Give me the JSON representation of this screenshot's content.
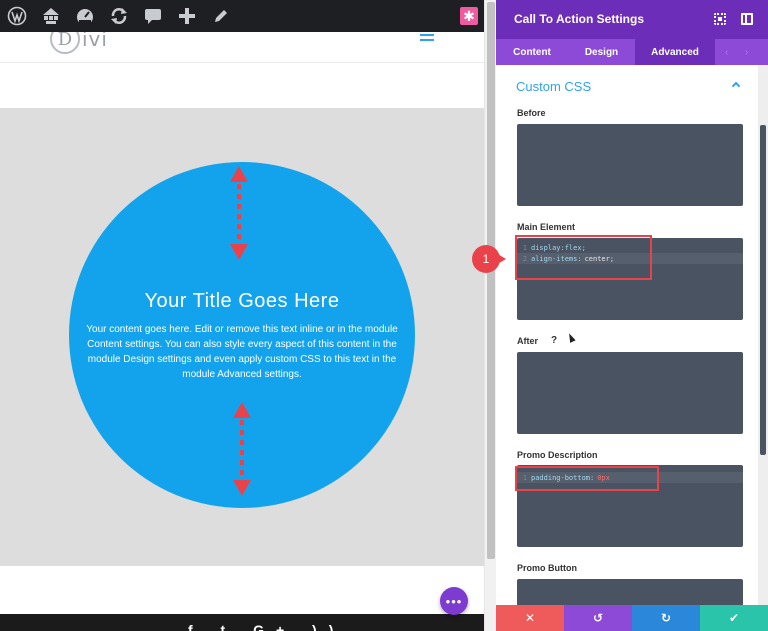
{
  "admin_bar": {
    "icons": [
      "wordpress-icon",
      "sitemap-icon",
      "dashboard-icon",
      "refresh-icon",
      "comment-icon",
      "plus-icon",
      "edit-icon"
    ],
    "star_icon": "star-icon"
  },
  "site": {
    "logo_letter": "D",
    "logo_text": "ivi"
  },
  "cta": {
    "title": "Your Title Goes Here",
    "description": "Your content goes here. Edit or remove this text inline or in the module Content settings. You can also style every aspect of this content in the module Design settings and even apply custom CSS to this text in the module Advanced settings.",
    "background": "#13a3ec"
  },
  "footer": {
    "social": "f  t  G+  ))",
    "menu_button": "•••"
  },
  "panel": {
    "title": "Call To Action Settings",
    "tabs": [
      {
        "label": "Content"
      },
      {
        "label": "Design"
      },
      {
        "label": "Advanced"
      }
    ],
    "section_title": "Custom CSS",
    "fields": {
      "before": "Before",
      "main_element": "Main Element",
      "after": "After",
      "promo_description": "Promo Description",
      "promo_button": "Promo Button"
    },
    "main_code": [
      {
        "line": "1",
        "prop": "display:flex;",
        "val": ""
      },
      {
        "line": "2",
        "prop": "align-items:",
        "val": "center;"
      }
    ],
    "promo_code": [
      {
        "line": "1",
        "prop": "padding-bottom:",
        "val": "0px"
      }
    ],
    "help": "?",
    "footer_buttons": [
      {
        "icon": "close-icon",
        "glyph": "✕",
        "color": "#ef5b5b"
      },
      {
        "icon": "undo-icon",
        "glyph": "↺",
        "color": "#8d4ad6"
      },
      {
        "icon": "redo-icon",
        "glyph": "↻",
        "color": "#2b87da"
      },
      {
        "icon": "check-icon",
        "glyph": "✔",
        "color": "#29c4a9"
      }
    ]
  },
  "annotation": {
    "number": "1",
    "color": "#e9424b"
  },
  "colors": {
    "panel_header": "#6c2eb9",
    "tabs": "#8d4ad6",
    "accent": "#2ea3f2",
    "code_bg": "#4a5361"
  }
}
